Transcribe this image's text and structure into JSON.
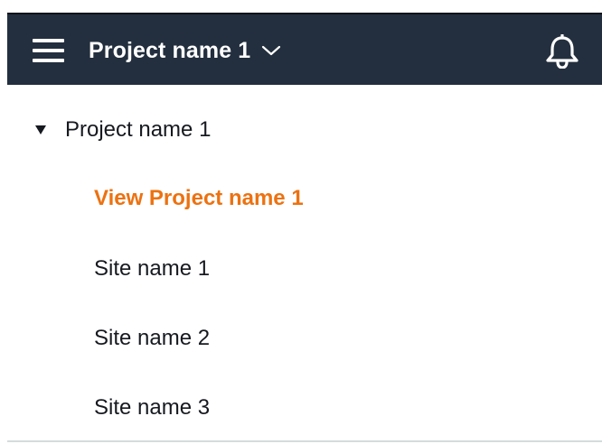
{
  "header": {
    "project_title": "Project name 1",
    "icons": {
      "menu": "hamburger-menu-icon",
      "switcher": "chevron-down-icon",
      "notifications": "bell-icon"
    }
  },
  "nav": {
    "group_label": "Project name 1",
    "expanded": true,
    "items": [
      {
        "label": "View Project name 1",
        "active": true
      },
      {
        "label": "Site name 1",
        "active": false
      },
      {
        "label": "Site name 2",
        "active": false
      },
      {
        "label": "Site name 3",
        "active": false
      }
    ]
  },
  "colors": {
    "header_bg": "#232f3e",
    "active_link": "#ec7211",
    "text": "#16191f"
  }
}
